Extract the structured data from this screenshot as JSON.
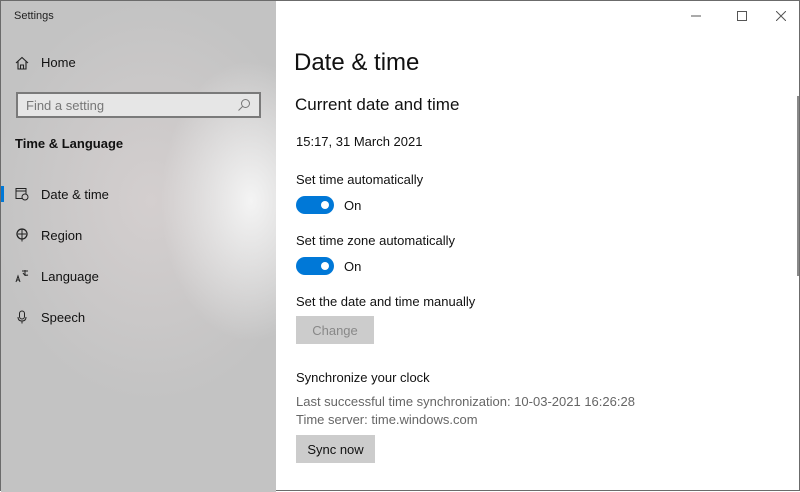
{
  "window": {
    "title": "Settings",
    "minimize_icon": "minimize-icon",
    "maximize_icon": "maximize-icon",
    "close_icon": "close-icon"
  },
  "sidebar": {
    "home": "Home",
    "search_placeholder": "Find a setting",
    "section": "Time & Language",
    "items": [
      {
        "label": "Date & time",
        "icon": "calendar-clock-icon",
        "active": true
      },
      {
        "label": "Region",
        "icon": "globe-icon"
      },
      {
        "label": "Language",
        "icon": "language-icon"
      },
      {
        "label": "Speech",
        "icon": "microphone-icon"
      }
    ]
  },
  "main": {
    "title": "Date & time",
    "subtitle": "Current date and time",
    "current": "15:17, 31 March 2021",
    "auto_time_label": "Set time automatically",
    "auto_time_state": "On",
    "auto_zone_label": "Set time zone automatically",
    "auto_zone_state": "On",
    "manual_label": "Set the date and time manually",
    "change_button": "Change",
    "sync_heading": "Synchronize your clock",
    "last_sync": "Last successful time synchronization: 10-03-2021 16:26:28",
    "time_server": "Time server: time.windows.com",
    "sync_button": "Sync now"
  },
  "colors": {
    "accent": "#0078d7"
  }
}
